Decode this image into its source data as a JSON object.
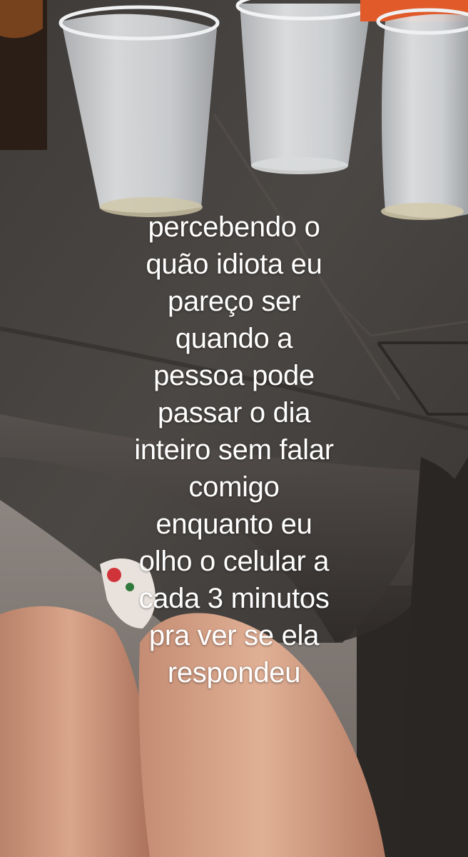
{
  "caption": {
    "lines": [
      "percebendo o",
      "quão idiota eu",
      "pareço ser",
      "quando a",
      "pessoa pode",
      "passar o dia",
      "inteiro sem falar",
      "comigo",
      "enquanto eu",
      "olho o celular a",
      "cada 3 minutos",
      "pra ver se ela",
      "respondeu"
    ],
    "color": "#ffffff"
  }
}
